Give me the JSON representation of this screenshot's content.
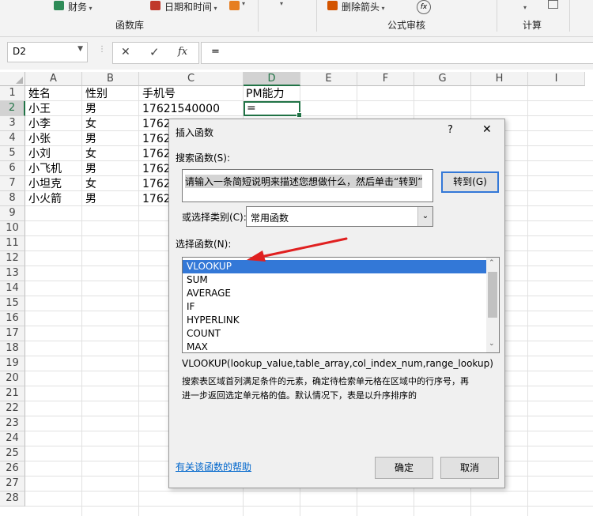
{
  "ribbon": {
    "finance_label": "财务",
    "datetime_label": "日期和时间",
    "remove_arrows_label": "删除箭头",
    "function_library_label": "函数库",
    "formula_audit_label": "公式审核",
    "calculation_label": "计算"
  },
  "formula_bar": {
    "name_box": "D2",
    "cancel_glyph": "✕",
    "enter_glyph": "✓",
    "fx_label": "fx",
    "content": "="
  },
  "columns": [
    "A",
    "B",
    "C",
    "D",
    "E",
    "F",
    "G",
    "H",
    "I"
  ],
  "rows": [
    "1",
    "2",
    "3",
    "4",
    "5",
    "6",
    "7",
    "8",
    "9",
    "10",
    "11",
    "12",
    "13",
    "14",
    "15",
    "16",
    "17",
    "18",
    "19",
    "20",
    "21",
    "22",
    "23",
    "24",
    "25",
    "26",
    "27",
    "28"
  ],
  "cells": {
    "r1": [
      "姓名",
      "性别",
      "手机号",
      "PM能力"
    ],
    "r2": [
      "小王",
      "男",
      "17621540000",
      "="
    ],
    "r3": [
      "小李",
      "女",
      "1762"
    ],
    "r4": [
      "小张",
      "男",
      "1762"
    ],
    "r5": [
      "小刘",
      "女",
      "1762"
    ],
    "r6": [
      "小飞机",
      "男",
      "1762"
    ],
    "r7": [
      "小坦克",
      "女",
      "1762"
    ],
    "r8": [
      "小火箭",
      "男",
      "1762"
    ]
  },
  "dialog": {
    "title": "插入函数",
    "help_glyph": "?",
    "close_glyph": "✕",
    "search_label": "搜索函数(S):",
    "search_value": "请输入一条简短说明来描述您想做什么，然后单击“转到”",
    "goto_label": "转到(G)",
    "category_label": "或选择类别(C):",
    "category_value": "常用函数",
    "select_label": "选择函数(N):",
    "functions": [
      "VLOOKUP",
      "SUM",
      "AVERAGE",
      "IF",
      "HYPERLINK",
      "COUNT",
      "MAX"
    ],
    "selected_index": 0,
    "syntax": "VLOOKUP(lookup_value,table_array,col_index_num,range_lookup)",
    "description_line1": "搜索表区域首列满足条件的元素，确定待检索单元格在区域中的行序号，再",
    "description_line2": "进一步返回选定单元格的值。默认情况下，表是以升序排序的",
    "help_link": "有关该函数的帮助",
    "ok_label": "确定",
    "cancel_label": "取消"
  },
  "colors": {
    "selection_blue": "#3378d7",
    "annotation_red": "#e02020",
    "excel_green": "#217346",
    "link_blue": "#0066cc"
  }
}
